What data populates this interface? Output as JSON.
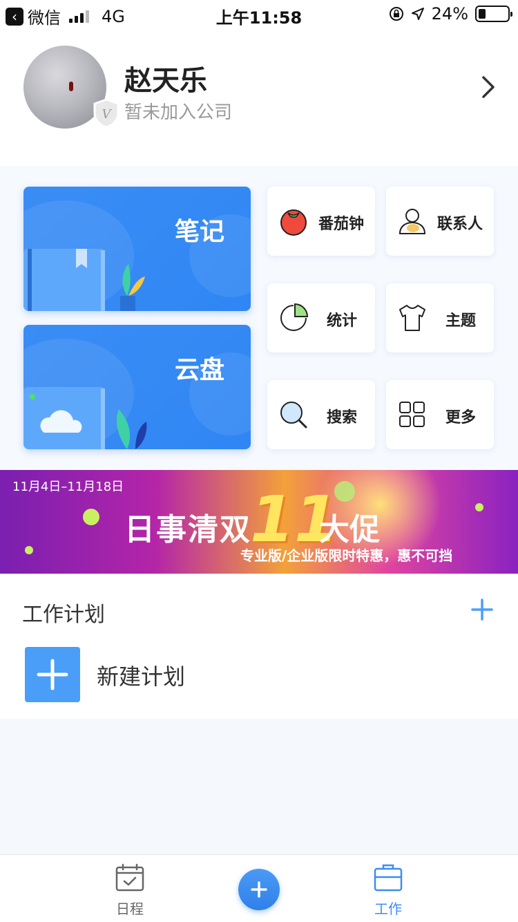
{
  "status_bar": {
    "back_app": "微信",
    "network": "4G",
    "time": "上午11:58",
    "battery": "24%",
    "battery_level": 0.24
  },
  "profile": {
    "name": "赵天乐",
    "subtitle": "暂未加入公司"
  },
  "grid": {
    "notes_label": "笔记",
    "cloud_label": "云盘",
    "items": [
      {
        "label": "番茄钟",
        "icon": "tomato-icon"
      },
      {
        "label": "联系人",
        "icon": "contact-icon"
      },
      {
        "label": "统计",
        "icon": "pie-chart-icon"
      },
      {
        "label": "主题",
        "icon": "tshirt-icon"
      },
      {
        "label": "搜索",
        "icon": "search-icon"
      },
      {
        "label": "更多",
        "icon": "grid-more-icon"
      }
    ]
  },
  "banner": {
    "date_range": "11月4日–11月18日",
    "headline": "日事清双",
    "number": "11",
    "promo": "大促",
    "subtitle": "专业版/企业版限时特惠，惠不可挡"
  },
  "plan": {
    "title": "工作计划",
    "new_label": "新建计划"
  },
  "tabbar": {
    "schedule_label": "日程",
    "work_label": "工作",
    "active_color": "#3b8df5",
    "inactive_color": "#666666"
  }
}
